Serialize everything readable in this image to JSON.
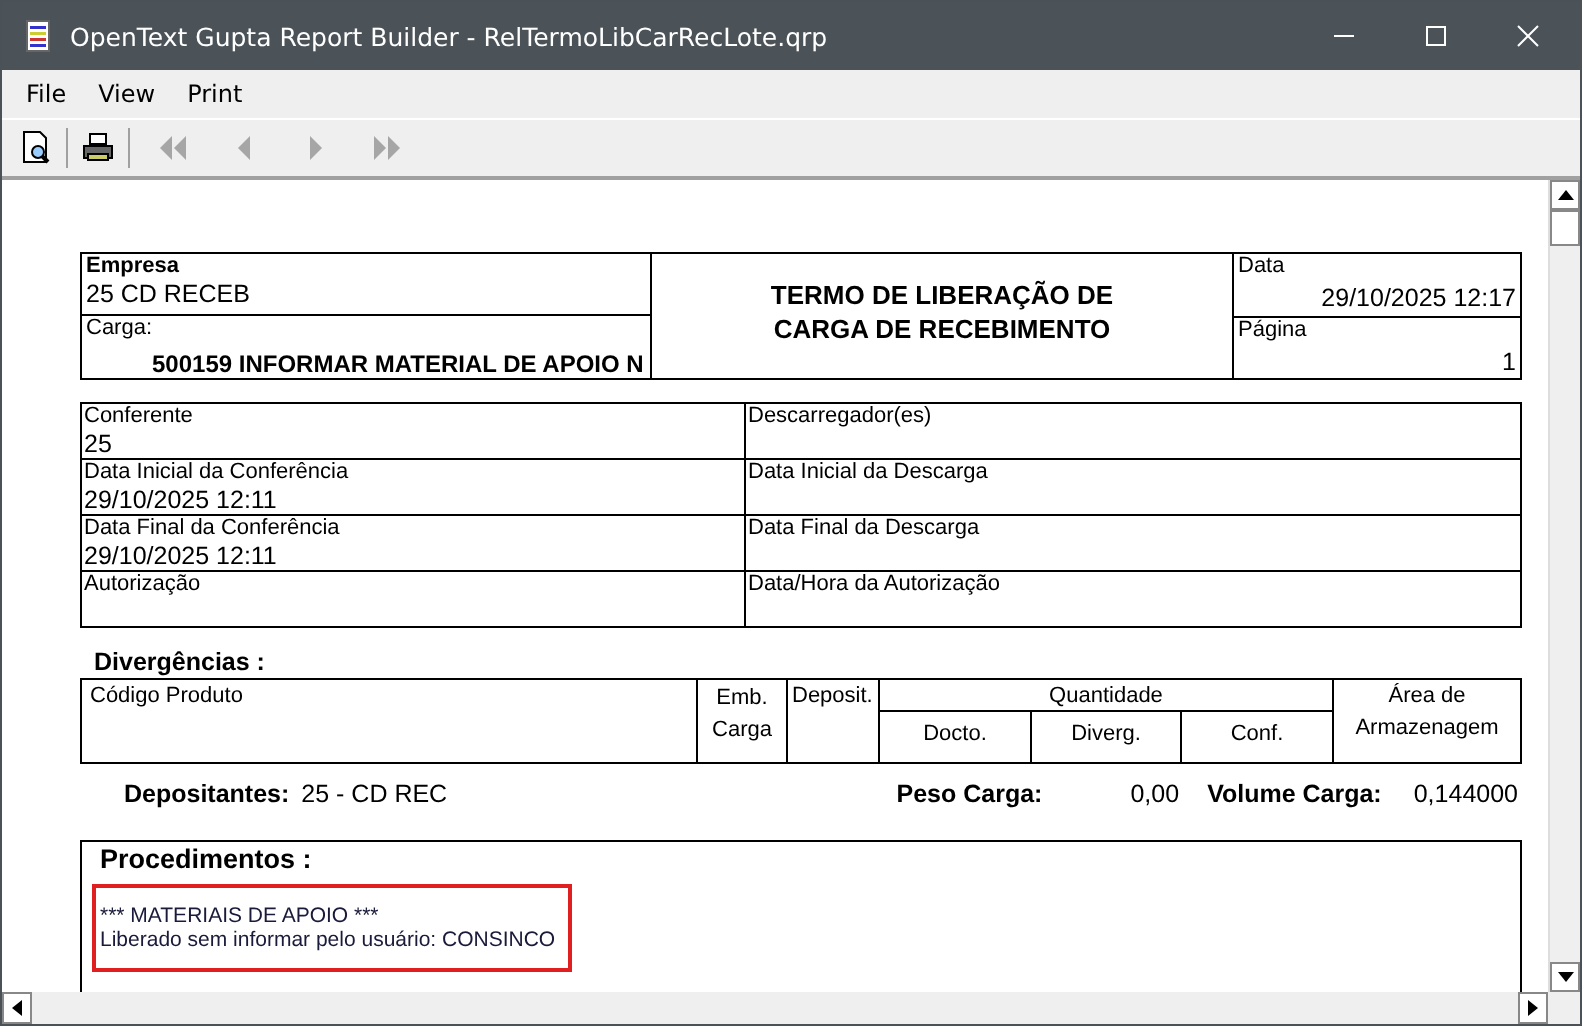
{
  "window": {
    "title": "OpenText Gupta Report Builder - RelTermoLibCarRecLote.qrp"
  },
  "menu": [
    "File",
    "View",
    "Print"
  ],
  "toolbar": [
    {
      "kind": "preview",
      "disabled": false
    },
    {
      "kind": "print",
      "disabled": false
    },
    {
      "kind": "first",
      "disabled": true
    },
    {
      "kind": "prev",
      "disabled": true
    },
    {
      "kind": "next",
      "disabled": true
    },
    {
      "kind": "last",
      "disabled": true
    }
  ],
  "report": {
    "header": {
      "company_label": "Empresa",
      "company": "25 CD RECEB",
      "cargo_label": "Carga:",
      "cargo": "500159 INFORMAR MATERIAL DE APOIO N",
      "title_lines": [
        "TERMO DE LIBERAÇÃO DE",
        "CARGA DE RECEBIMENTO"
      ],
      "date_label": "Data",
      "date": "29/10/2025  12:17",
      "page_label": "Página",
      "page": "1"
    },
    "info_rows": [
      {
        "left_label": "Conferente",
        "left_value": "25",
        "right_label": "Descarregador(es)"
      },
      {
        "left_label": "Data Inicial da Conferência",
        "left_value": "29/10/2025 12:11",
        "right_label": "Data Inicial da Descarga"
      },
      {
        "left_label": "Data Final da Conferência",
        "left_value": "29/10/2025 12:11",
        "right_label": "Data Final da Descarga"
      },
      {
        "left_label": "Autorização",
        "right_label": "Data/Hora da Autorização"
      }
    ],
    "divergences": {
      "title": "Divergências :",
      "code_product": "Código  Produto",
      "package": "Emb. Carga",
      "depositor": "Deposit.",
      "quantity": "Quantidade",
      "quantity_columns": [
        "Docto.",
        "Diverg.",
        "Conf."
      ],
      "storage_area": "Área de Armazenagem"
    },
    "summary": {
      "depositors_label": "Depositantes:",
      "depositors": "25 - CD REC",
      "weight_label": "Peso Carga:",
      "weight": "0,00",
      "volume_label": "Volume Carga:",
      "volume": "0,144000"
    },
    "procedures": {
      "title": "Procedimentos :",
      "highlighted": true,
      "lines": [
        "*** MATERIAIS DE APOIO ***",
        "Liberado sem informar pelo usuário: CONSINCO"
      ]
    }
  }
}
